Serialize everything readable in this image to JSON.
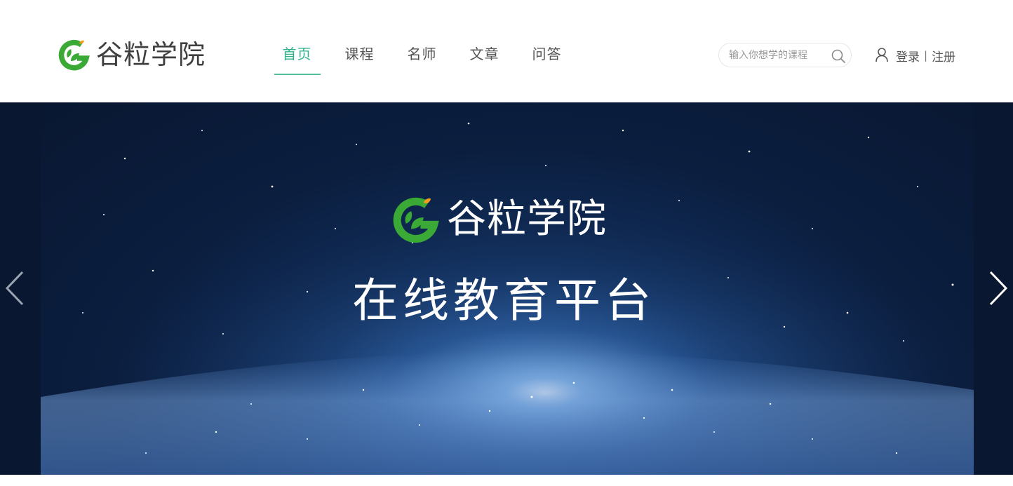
{
  "brand": {
    "name": "谷粒学院",
    "primary_color": "#2fb38e",
    "logo_green": "#3aa935",
    "logo_leaf_orange": "#f39a1e"
  },
  "nav": {
    "items": [
      {
        "label": "首页",
        "active": true
      },
      {
        "label": "课程",
        "active": false
      },
      {
        "label": "名师",
        "active": false
      },
      {
        "label": "文章",
        "active": false
      },
      {
        "label": "问答",
        "active": false
      }
    ]
  },
  "search": {
    "placeholder": "输入你想学的课程",
    "icon": "search-icon"
  },
  "auth": {
    "user_icon": "user-icon",
    "login_label": "登录",
    "separator": "|",
    "register_label": "注册"
  },
  "banner": {
    "brand_name": "谷粒学院",
    "slogan": "在线教育平台",
    "prev_icon": "chevron-left-icon",
    "next_icon": "chevron-right-icon"
  }
}
